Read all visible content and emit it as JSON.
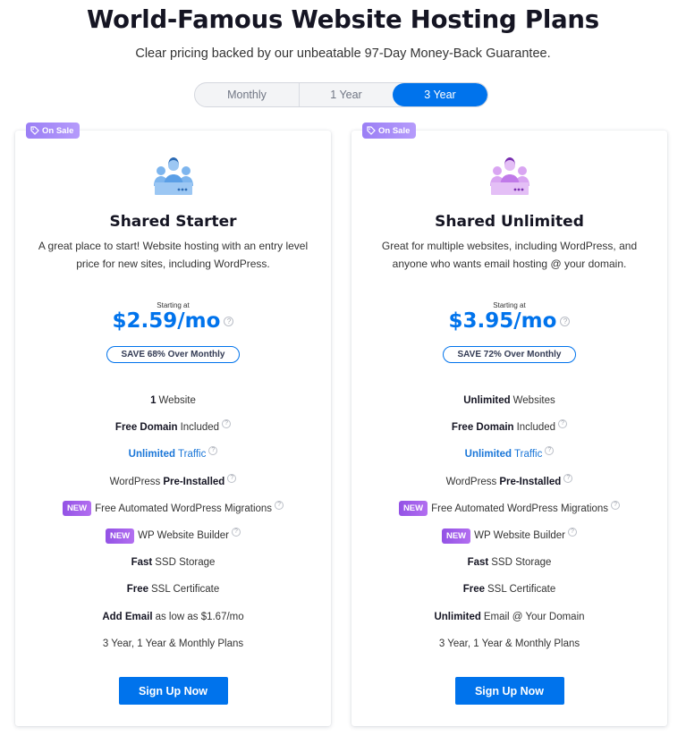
{
  "header": {
    "title": "World-Famous Website Hosting Plans",
    "subtitle": "Clear pricing backed by our unbeatable 97-Day Money-Back Guarantee."
  },
  "billing_toggle": {
    "options": [
      "Monthly",
      "1 Year",
      "3 Year"
    ],
    "selected": "3 Year"
  },
  "colors": {
    "accent": "#0073ec",
    "sale_badge": "#a78bfa",
    "new_badge": "#9e5ce8",
    "starter_icon": "#5b9fe6",
    "unlimited_icon": "#c07ae9"
  },
  "plans": [
    {
      "sale_badge": "On Sale",
      "icon": "users-group-icon",
      "name": "Shared Starter",
      "description": "A great place to start! Website hosting with an entry level price for new sites, including WordPress.",
      "starting_label": "Starting at",
      "price": "$2.59/mo",
      "save_label": "SAVE 68% Over Monthly",
      "features": [
        {
          "bold": "1",
          "text": "Website"
        },
        {
          "bold": "Free Domain",
          "text": "Included",
          "help": "?"
        },
        {
          "bold": "Unlimited",
          "text": "Traffic",
          "help": "?"
        },
        {
          "text": "WordPress",
          "bold_after": "Pre-Installed",
          "help": "?"
        },
        {
          "badge": "NEW",
          "text": "Free Automated WordPress Migrations",
          "help": "?"
        },
        {
          "badge": "NEW",
          "text": "WP Website Builder",
          "help": "?"
        },
        {
          "bold": "Fast",
          "text": "SSD Storage"
        },
        {
          "bold": "Free",
          "text": "SSL Certificate"
        },
        {
          "bold": "Add Email",
          "text": "as low as $1.67/mo"
        },
        {
          "text": "3 Year, 1 Year & Monthly Plans"
        }
      ],
      "button": "Sign Up Now"
    },
    {
      "sale_badge": "On Sale",
      "icon": "users-group-icon",
      "name": "Shared Unlimited",
      "description": "Great for multiple websites, including WordPress, and anyone who wants email hosting @ your domain.",
      "starting_label": "Starting at",
      "price": "$3.95/mo",
      "save_label": "SAVE 72% Over Monthly",
      "features": [
        {
          "bold": "Unlimited",
          "text": "Websites"
        },
        {
          "bold": "Free Domain",
          "text": "Included",
          "help": "?"
        },
        {
          "bold": "Unlimited",
          "text": "Traffic",
          "help": "?"
        },
        {
          "text": "WordPress",
          "bold_after": "Pre-Installed",
          "help": "?"
        },
        {
          "badge": "NEW",
          "text": "Free Automated WordPress Migrations",
          "help": "?"
        },
        {
          "badge": "NEW",
          "text": "WP Website Builder",
          "help": "?"
        },
        {
          "bold": "Fast",
          "text": "SSD Storage"
        },
        {
          "bold": "Free",
          "text": "SSL Certificate"
        },
        {
          "bold": "Unlimited",
          "text": "Email @ Your Domain"
        },
        {
          "text": "3 Year, 1 Year & Monthly Plans"
        }
      ],
      "button": "Sign Up Now"
    }
  ]
}
